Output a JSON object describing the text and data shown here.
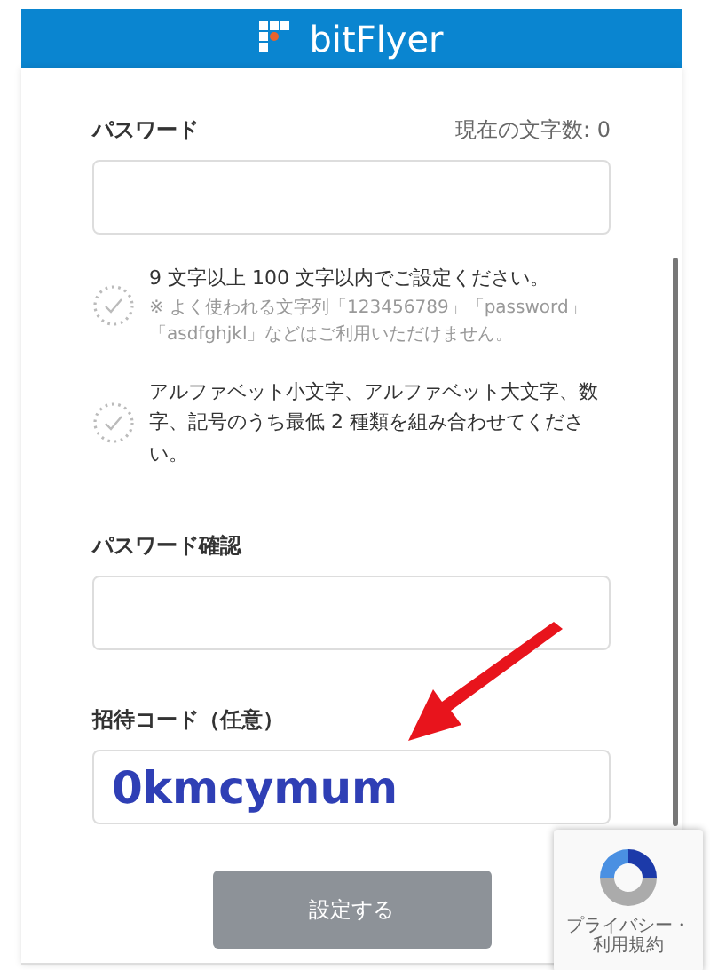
{
  "header": {
    "brand": "bitFlyer"
  },
  "password": {
    "label": "パスワード",
    "counter": "現在の文字数: 0"
  },
  "rules": [
    {
      "met": false,
      "text": "9 文字以上 100 文字以内でご設定ください。",
      "note": "※ よく使われる文字列「123456789」「password」「asdfghjkl」などはご利用いただけません。"
    },
    {
      "met": false,
      "text": "アルファベット小文字、アルファベット大文字、数字、記号のうち最低 2 種類を組み合わせてください。"
    }
  ],
  "confirm": {
    "label": "パスワード確認"
  },
  "invite": {
    "label": "招待コード（任意）",
    "value": "0kmcymum"
  },
  "submit": {
    "label": "設定する",
    "disabled": true
  },
  "recaptcha": {
    "links": "プライバシー・利用規約"
  }
}
